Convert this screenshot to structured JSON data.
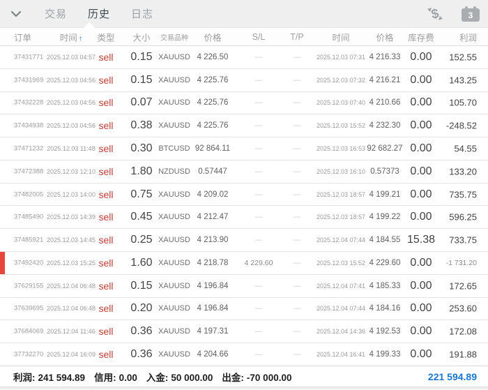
{
  "topbar": {
    "tabs": [
      {
        "label": "交易",
        "active": false
      },
      {
        "label": "历史",
        "active": true
      },
      {
        "label": "日志",
        "active": false
      }
    ],
    "calendar_badge": "3"
  },
  "table": {
    "headers": {
      "order": "订单",
      "open_time": "时间",
      "sort_arrow": "↑",
      "type": "类型",
      "volume": "大小",
      "symbol": "交易品种",
      "open_price": "价格",
      "sl": "S/L",
      "tp": "T/P",
      "close_time": "时间",
      "close_price": "价格",
      "swap": "库存费",
      "profit": "利润"
    },
    "rows": [
      {
        "order": "37431771",
        "open_time": "2025.12.03 04:57",
        "type": "sell",
        "volume": "0.15",
        "symbol": "XAUUSD",
        "open_price": "4 226.50",
        "sl": "—",
        "tp": "—",
        "close_time": "2025.12.03 07:31",
        "close_price": "4 216.33",
        "swap": "0.00",
        "profit": "152.55",
        "highlighted": false
      },
      {
        "order": "37431969",
        "open_time": "2025.12.03 04:56",
        "type": "sell",
        "volume": "0.15",
        "symbol": "XAUUSD",
        "open_price": "4 225.76",
        "sl": "—",
        "tp": "—",
        "close_time": "2025.12.03 07:32",
        "close_price": "4 216.21",
        "swap": "0.00",
        "profit": "143.25",
        "highlighted": false
      },
      {
        "order": "37432228",
        "open_time": "2025.12.03 04:56",
        "type": "sell",
        "volume": "0.07",
        "symbol": "XAUUSD",
        "open_price": "4 225.76",
        "sl": "—",
        "tp": "—",
        "close_time": "2025.12.03 07:40",
        "close_price": "4 210.66",
        "swap": "0.00",
        "profit": "105.70",
        "highlighted": false
      },
      {
        "order": "37434938",
        "open_time": "2025.12.03 04:56",
        "type": "sell",
        "volume": "0.38",
        "symbol": "XAUUSD",
        "open_price": "4 225.76",
        "sl": "—",
        "tp": "—",
        "close_time": "2025.12.03 15:52",
        "close_price": "4 232.30",
        "swap": "0.00",
        "profit": "-248.52",
        "highlighted": false
      },
      {
        "order": "37471232",
        "open_time": "2025.12.03 11:48",
        "type": "sell",
        "volume": "0.30",
        "symbol": "BTCUSD",
        "open_price": "92 864.11",
        "sl": "—",
        "tp": "—",
        "close_time": "2025.12.03 16:53",
        "close_price": "92 682.27",
        "swap": "0.00",
        "profit": "54.55",
        "highlighted": false
      },
      {
        "order": "37472388",
        "open_time": "2025.12.03 12:10",
        "type": "sell",
        "volume": "1.80",
        "symbol": "NZDUSD",
        "open_price": "0.57447",
        "sl": "—",
        "tp": "—",
        "close_time": "2025.12.03 16:10",
        "close_price": "0.57373",
        "swap": "0.00",
        "profit": "133.20",
        "highlighted": false
      },
      {
        "order": "37482005",
        "open_time": "2025.12.03 14:00",
        "type": "sell",
        "volume": "0.75",
        "symbol": "XAUUSD",
        "open_price": "4 209.02",
        "sl": "—",
        "tp": "—",
        "close_time": "2025.12.03 18:57",
        "close_price": "4 199.21",
        "swap": "0.00",
        "profit": "735.75",
        "highlighted": false
      },
      {
        "order": "37485490",
        "open_time": "2025.12.03 14:39",
        "type": "sell",
        "volume": "0.45",
        "symbol": "XAUUSD",
        "open_price": "4 212.47",
        "sl": "—",
        "tp": "—",
        "close_time": "2025.12.03 18:57",
        "close_price": "4 199.22",
        "swap": "0.00",
        "profit": "596.25",
        "highlighted": false
      },
      {
        "order": "37485921",
        "open_time": "2025.12.03 14:45",
        "type": "sell",
        "volume": "0.25",
        "symbol": "XAUUSD",
        "open_price": "4 213.90",
        "sl": "—",
        "tp": "—",
        "close_time": "2025.12.04 07:44",
        "close_price": "4 184.55",
        "swap": "15.38",
        "profit": "733.75",
        "highlighted": false
      },
      {
        "order": "37492420",
        "open_time": "2025.12.03 15:25",
        "type": "sell",
        "volume": "1.60",
        "symbol": "XAUUSD",
        "open_price": "4 218.78",
        "sl": "4 229.60",
        "tp": "—",
        "close_time": "2025.12.03 15:52",
        "close_price": "4 229.60",
        "swap": "0.00",
        "profit": "-1 731.20",
        "highlighted": true
      },
      {
        "order": "37629155",
        "open_time": "2025.12.04 06:48",
        "type": "sell",
        "volume": "0.15",
        "symbol": "XAUUSD",
        "open_price": "4 196.84",
        "sl": "—",
        "tp": "—",
        "close_time": "2025.12.04 07:41",
        "close_price": "4 185.33",
        "swap": "0.00",
        "profit": "172.65",
        "highlighted": false
      },
      {
        "order": "37639695",
        "open_time": "2025.12.04 06:48",
        "type": "sell",
        "volume": "0.20",
        "symbol": "XAUUSD",
        "open_price": "4 196.84",
        "sl": "—",
        "tp": "—",
        "close_time": "2025.12.04 07:44",
        "close_price": "4 184.16",
        "swap": "0.00",
        "profit": "253.60",
        "highlighted": false
      },
      {
        "order": "37684069",
        "open_time": "2025.12.04 11:46",
        "type": "sell",
        "volume": "0.36",
        "symbol": "XAUUSD",
        "open_price": "4 197.31",
        "sl": "—",
        "tp": "—",
        "close_time": "2025.12.04 14:36",
        "close_price": "4 192.53",
        "swap": "0.00",
        "profit": "172.08",
        "highlighted": false
      },
      {
        "order": "37732270",
        "open_time": "2025.12.04 16:09",
        "type": "sell",
        "volume": "0.36",
        "symbol": "XAUUSD",
        "open_price": "4 204.66",
        "sl": "—",
        "tp": "—",
        "close_time": "2025.12.04 16:41",
        "close_price": "4 199.33",
        "swap": "0.00",
        "profit": "191.88",
        "highlighted": false
      }
    ]
  },
  "summary": {
    "profit_label": "利润:",
    "profit_value": "241 594.89",
    "credit_label": "信用:",
    "credit_value": "0.00",
    "deposit_label": "入金:",
    "deposit_value": "50 000.00",
    "withdrawal_label": "出金:",
    "withdrawal_value": "-70 000.00",
    "total": "221 594.89"
  },
  "colors": {
    "sell_red": "#bf4036",
    "marker_red": "#e8453c",
    "sort_arrow_blue": "#1e88e5",
    "total_blue": "#1976d2",
    "topbar_bg": "#efeff0"
  }
}
